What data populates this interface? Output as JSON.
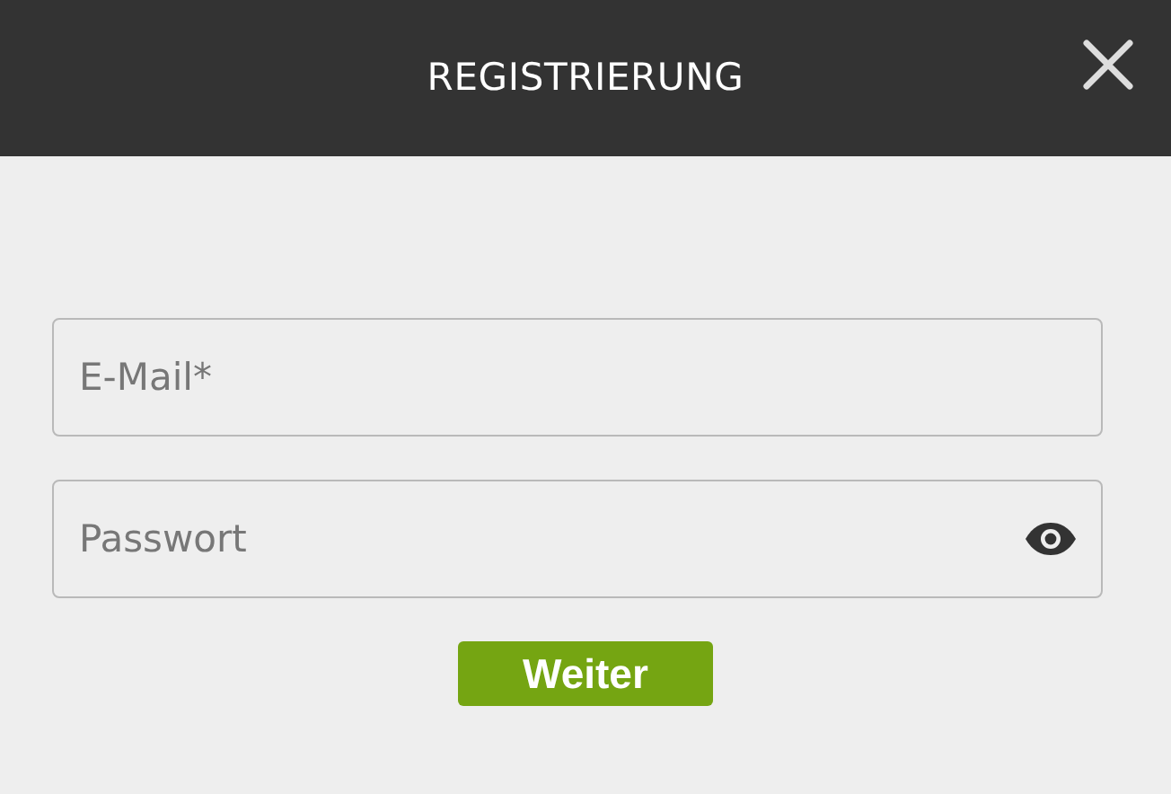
{
  "header": {
    "title": "REGISTRIERUNG"
  },
  "fields": [
    {
      "kind": "email",
      "placeholder": "E-Mail*"
    },
    {
      "kind": "password",
      "placeholder": "Passwort"
    }
  ],
  "button": {
    "label": "Weiter"
  }
}
